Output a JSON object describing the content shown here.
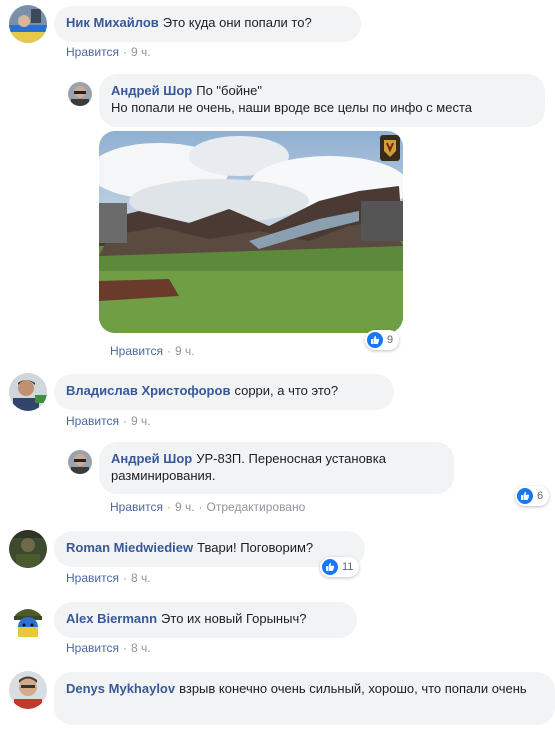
{
  "comments": [
    {
      "author": "Ник Михайлов",
      "text": "Это куда они попали то?",
      "like": "Нравится",
      "time": "9 ч."
    },
    {
      "author": "Андрей Шор",
      "text": "По \"бойне\"",
      "text2": "Но попали не очень, наши вроде все целы по инфо с места",
      "like": "Нравится",
      "time": "9 ч.",
      "reactions": "9"
    },
    {
      "author": "Владислав Христофоров",
      "text": "сорри, а что это?",
      "like": "Нравится",
      "time": "9 ч."
    },
    {
      "author": "Андрей Шор",
      "text": "УР-83П. Переносная установка разминирования.",
      "like": "Нравится",
      "time": "9 ч.",
      "edited": "Отредактировано",
      "reactions": "6"
    },
    {
      "author": "Roman Miedwiediew",
      "text": "Твари! Поговорим?",
      "like": "Нравится",
      "time": "8 ч.",
      "reactions": "11"
    },
    {
      "author": "Alex Biermann",
      "text": "Это их новый Горыныч?",
      "like": "Нравится",
      "time": "8 ч."
    },
    {
      "author": "Denys Mykhaylov",
      "text": "взрыв конечно очень сильный, хорошо, что попали очень"
    }
  ],
  "colors": {
    "author": "#385898",
    "bubble": "#f2f3f5",
    "like_badge": "#1877f2",
    "meta": "#90949c"
  },
  "icons": {
    "reaction": "like-thumb-icon",
    "photo_badge": "shield-emblem-icon"
  }
}
